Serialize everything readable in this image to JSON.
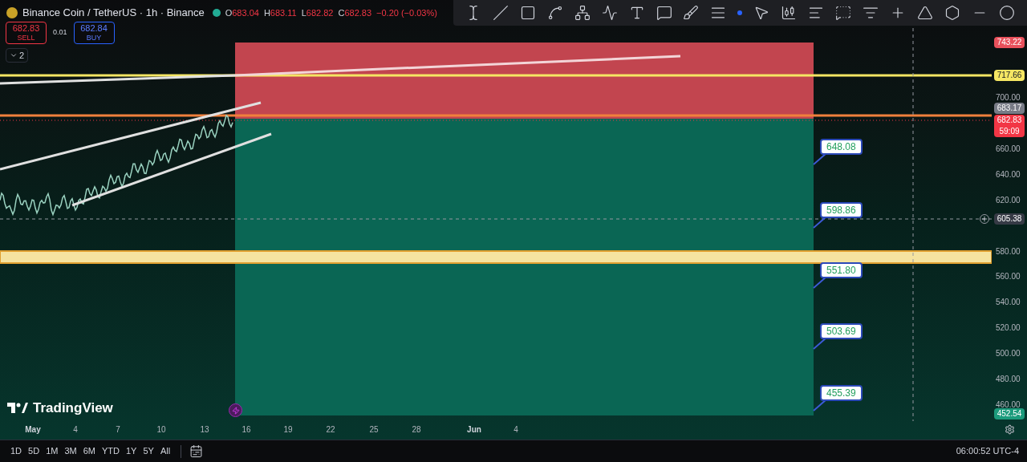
{
  "header": {
    "title": "Binance Coin / TetherUS · 1h · Binance",
    "ohlc": [
      {
        "label": "O",
        "value": "683.04"
      },
      {
        "label": "H",
        "value": "683.11"
      },
      {
        "label": "L",
        "value": "682.82"
      },
      {
        "label": "C",
        "value": "682.83"
      }
    ],
    "change": "−0.20 (−0.03%)"
  },
  "trade": {
    "sell": {
      "price": "682.83",
      "label": "SELL"
    },
    "spread": "0.01",
    "buy": {
      "price": "682.84",
      "label": "BUY"
    }
  },
  "collapse": {
    "count": "2"
  },
  "price_axis": {
    "ticks": [
      "700.00",
      "660.00",
      "640.00",
      "620.00",
      "580.00",
      "560.00",
      "540.00",
      "520.00",
      "500.00",
      "480.00",
      "460.00"
    ],
    "badges": [
      {
        "value": "743.22",
        "color": "#e8505b"
      },
      {
        "value": "717.66",
        "color": "#f5e663"
      },
      {
        "value": "683.17",
        "color": "#787b86"
      },
      {
        "value": "682.83",
        "sub": "59:09",
        "color": "#f23645"
      },
      {
        "value": "605.38",
        "color": "#363a45"
      },
      {
        "value": "452.54",
        "color": "#1c9b7c"
      }
    ]
  },
  "callouts": [
    "648.08",
    "598.86",
    "551.80",
    "503.69",
    "455.39"
  ],
  "logo": "TradingView",
  "time_axis": [
    {
      "label": "May",
      "kind": "month"
    },
    {
      "label": "4",
      "kind": "day"
    },
    {
      "label": "7",
      "kind": "day"
    },
    {
      "label": "10",
      "kind": "day"
    },
    {
      "label": "13",
      "kind": "day"
    },
    {
      "label": "16",
      "kind": "day"
    },
    {
      "label": "19",
      "kind": "day"
    },
    {
      "label": "22",
      "kind": "day"
    },
    {
      "label": "25",
      "kind": "day"
    },
    {
      "label": "28",
      "kind": "day"
    },
    {
      "label": "Jun",
      "kind": "month"
    },
    {
      "label": "4",
      "kind": "day"
    }
  ],
  "ranges": [
    "1D",
    "5D",
    "1M",
    "3M",
    "6M",
    "YTD",
    "1Y",
    "5Y",
    "All"
  ],
  "clock": "06:00:52 UTC-4"
}
